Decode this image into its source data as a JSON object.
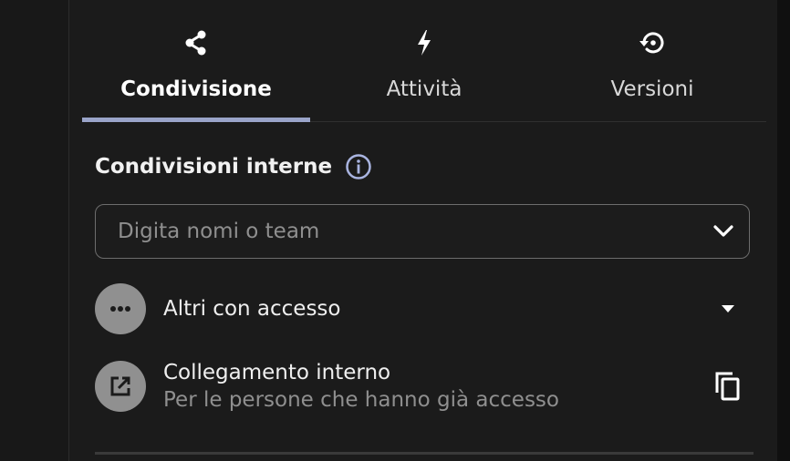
{
  "tabs": [
    {
      "label": "Condivisione",
      "icon": "share-icon",
      "active": true
    },
    {
      "label": "Attività",
      "icon": "lightning-icon",
      "active": false
    },
    {
      "label": "Versioni",
      "icon": "history-icon",
      "active": false
    }
  ],
  "section": {
    "title": "Condivisioni interne",
    "info_icon": "info-icon"
  },
  "search": {
    "placeholder": "Digita nomi o team"
  },
  "rows": {
    "others": {
      "title": "Altri con accesso",
      "icon": "more-horizontal-icon"
    },
    "link": {
      "title": "Collegamento interno",
      "subtitle": "Per le persone che hanno già accesso",
      "icon": "open-in-new-icon",
      "action_icon": "copy-icon"
    }
  },
  "colors": {
    "background": "#1b1b1b",
    "active_tab_indicator": "#9aa4c9",
    "info_icon": "#a9b4e0",
    "avatar": "#909090"
  }
}
